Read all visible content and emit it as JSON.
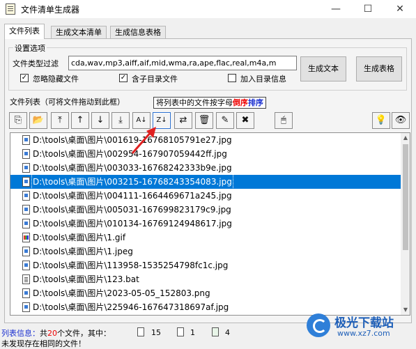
{
  "window": {
    "title": "文件清单生成器",
    "minimize": "—",
    "maximize": "☐",
    "close": "✕"
  },
  "tabs": [
    {
      "label": "文件列表",
      "active": true
    },
    {
      "label": "生成文本清单",
      "active": false
    },
    {
      "label": "生成信息表格",
      "active": false
    }
  ],
  "settings": {
    "group_label": "设置选项",
    "filter_label": "文件类型过滤",
    "filter_value": "cda,wav,mp3,aiff,aif,mid,wma,ra,ape,flac,real,m4a,m",
    "ignore_hidden": {
      "label": "忽略隐藏文件",
      "checked": true
    },
    "include_subdirs": {
      "label": "含子目录文件",
      "checked": true
    },
    "add_dir_info": {
      "label": "加入目录信息",
      "checked": false
    },
    "gen_text_btn": "生成文本",
    "gen_table_btn": "生成表格"
  },
  "filelist_section": {
    "label": "文件列表（可将文件拖动到此框）",
    "tooltip_prefix": "将列表中的文件按字母",
    "tooltip_red": "倒序",
    "tooltip_blue": "排序"
  },
  "toolbar": {
    "btn1": "⎘",
    "btn2": "📂",
    "btn3": "⤒",
    "btn4": "↑",
    "btn5": "↓",
    "btn6": "⤓",
    "btn7": "A↓",
    "btn8": "Z↓",
    "btn9": "⇄",
    "btn10": "🗑",
    "btn11": "✎",
    "btn12": "✖",
    "btn13": "🖱",
    "btn14": "💡",
    "btn15": "👁"
  },
  "files": [
    {
      "name": "D:\\tools\\桌面\\图片\\001619-16768105791e27.jpg",
      "type": "img",
      "selected": false
    },
    {
      "name": "D:\\tools\\桌面\\图片\\002954-167907059442ff.jpg",
      "type": "img",
      "selected": false
    },
    {
      "name": "D:\\tools\\桌面\\图片\\003033-16768242333b9e.jpg",
      "type": "img",
      "selected": false
    },
    {
      "name": "D:\\tools\\桌面\\图片\\003215-16768243354083.jpg",
      "type": "img",
      "selected": true
    },
    {
      "name": "D:\\tools\\桌面\\图片\\004111-1664469671a245.jpg",
      "type": "img",
      "selected": false
    },
    {
      "name": "D:\\tools\\桌面\\图片\\005031-167699823179c9.jpg",
      "type": "img",
      "selected": false
    },
    {
      "name": "D:\\tools\\桌面\\图片\\010134-16769124948617.jpg",
      "type": "img",
      "selected": false
    },
    {
      "name": "D:\\tools\\桌面\\图片\\1.gif",
      "type": "gif",
      "selected": false
    },
    {
      "name": "D:\\tools\\桌面\\图片\\1.jpeg",
      "type": "img",
      "selected": false
    },
    {
      "name": "D:\\tools\\桌面\\图片\\113958-1535254798fc1c.jpg",
      "type": "img",
      "selected": false
    },
    {
      "name": "D:\\tools\\桌面\\图片\\123.bat",
      "type": "bat",
      "selected": false
    },
    {
      "name": "D:\\tools\\桌面\\图片\\2023-05-05_152803.png",
      "type": "img",
      "selected": false
    },
    {
      "name": "D:\\tools\\桌面\\图片\\225946-167647318697af.jpg",
      "type": "img",
      "selected": false
    }
  ],
  "status": {
    "label": "列表信息：",
    "prefix": "共",
    "count": "20",
    "suffix": "个文件，其中：",
    "img_count": "15",
    "doc_count": "1",
    "other_count": "4",
    "line2": "未发现存在相同的文件！"
  },
  "watermark": {
    "text": "极光下载站",
    "url": "www.xz7.com"
  }
}
